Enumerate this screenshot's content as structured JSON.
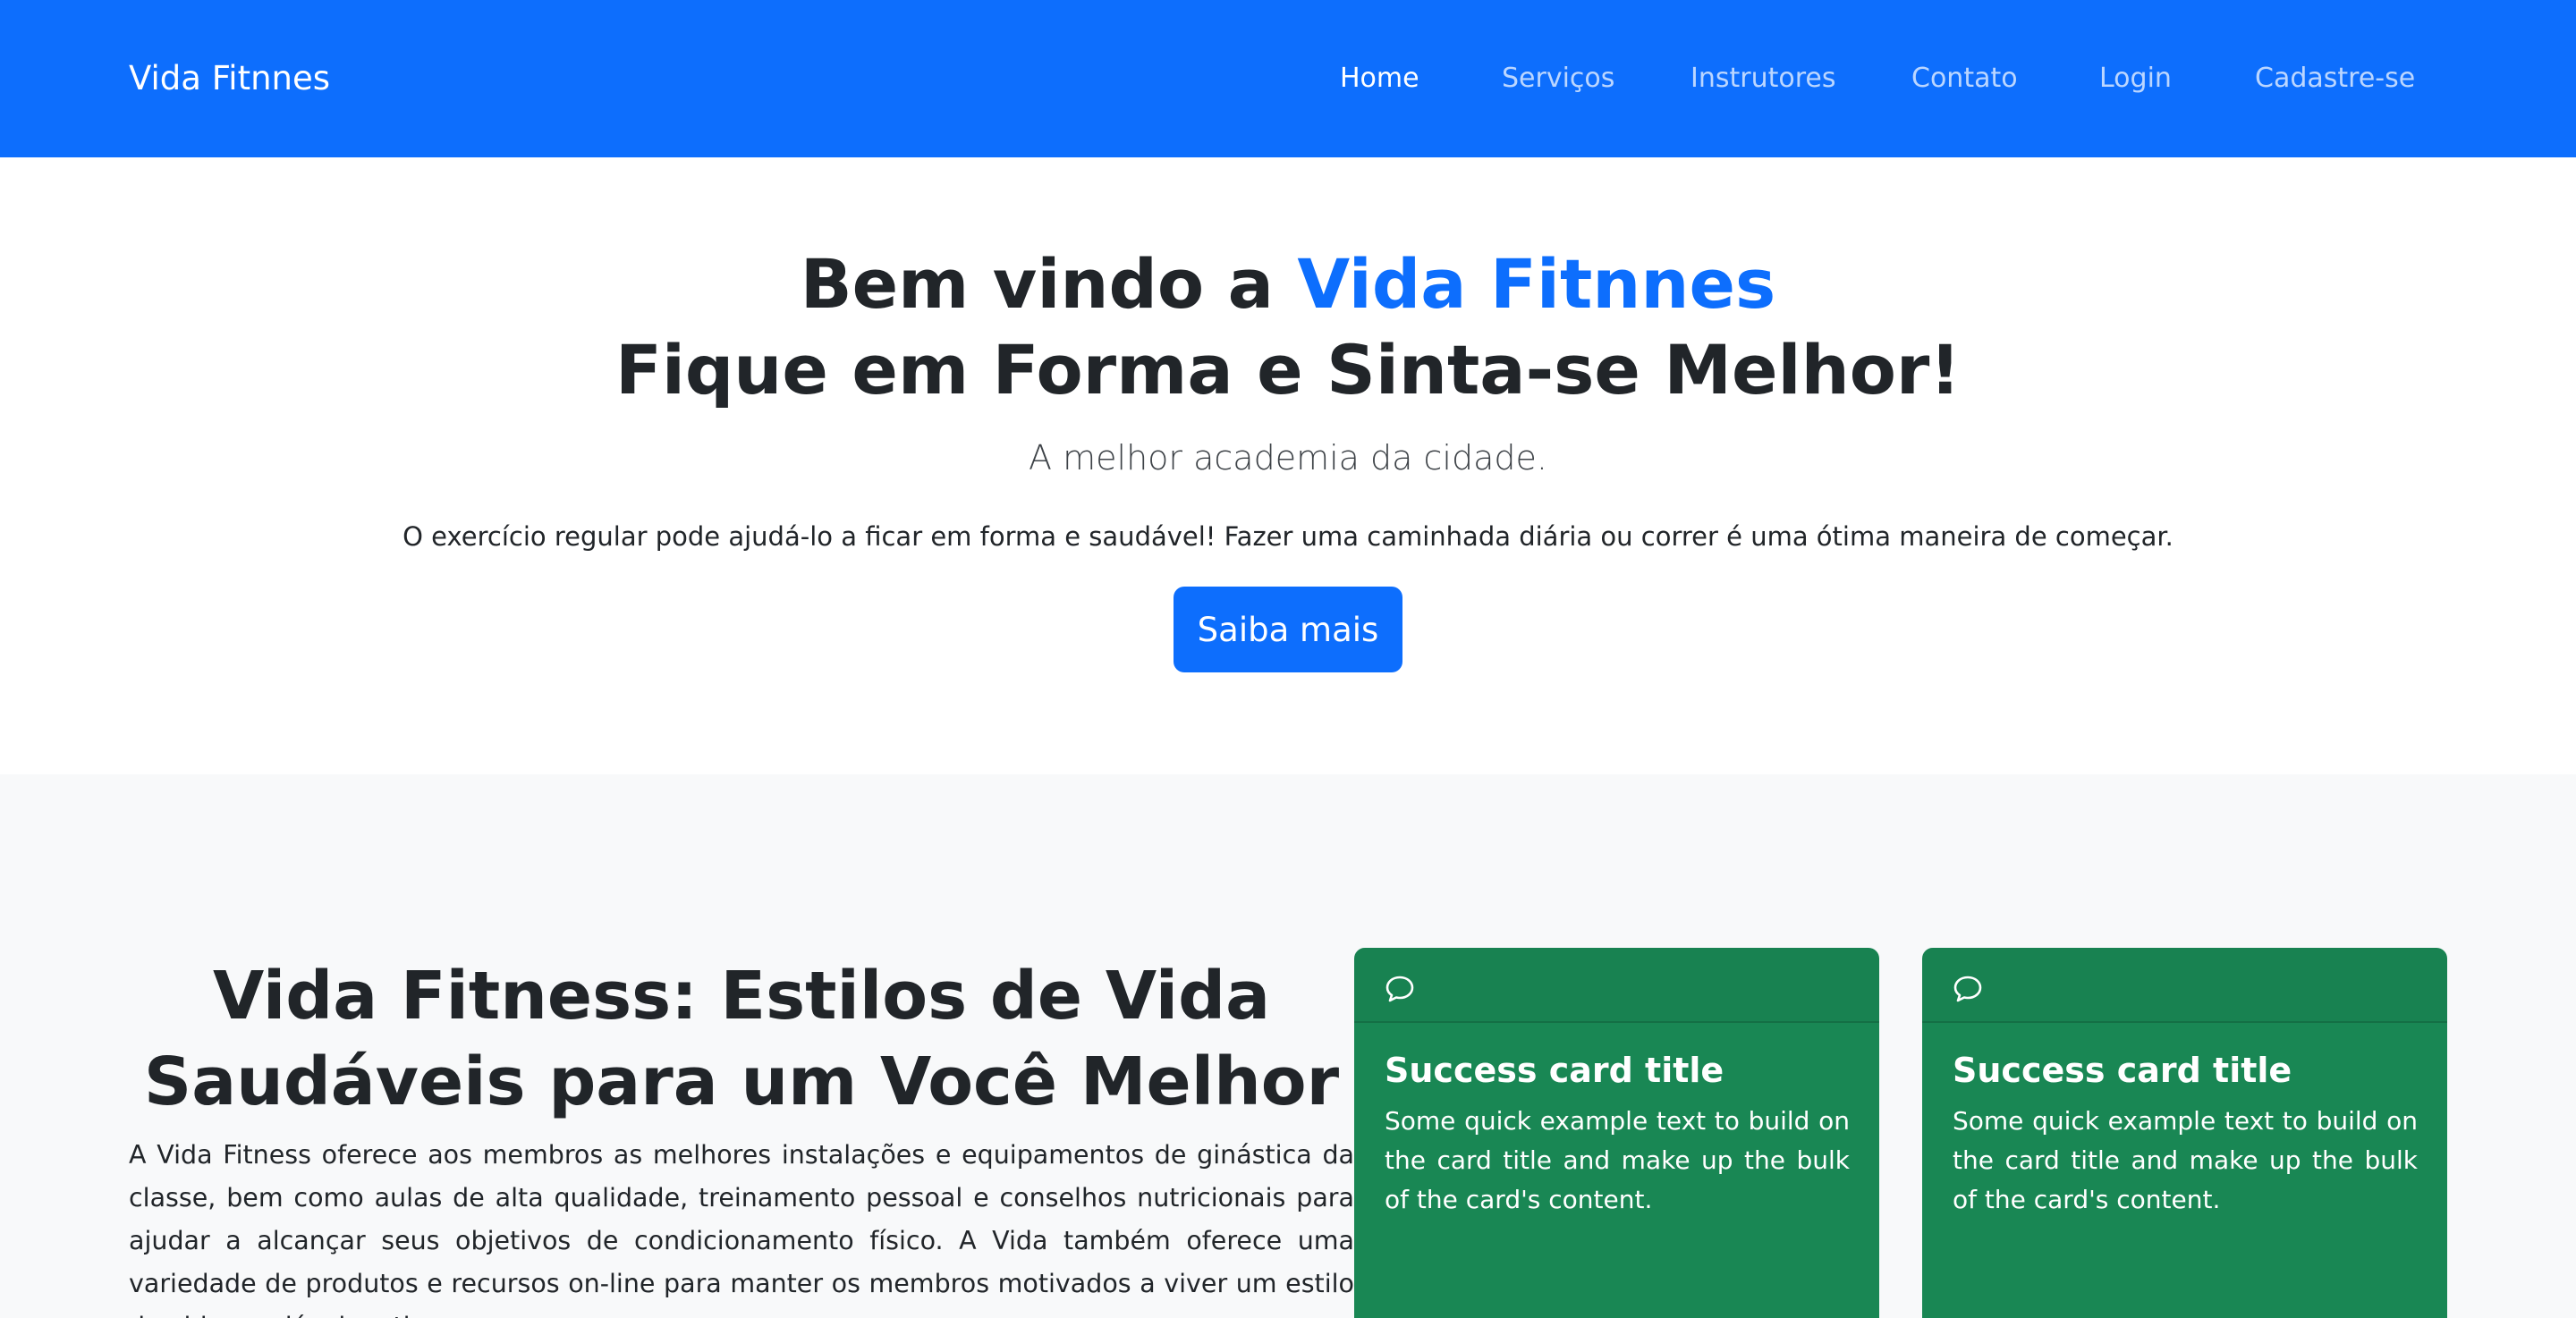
{
  "navbar": {
    "brand": "Vida Fitnnes",
    "links": [
      {
        "label": "Home",
        "active": true
      },
      {
        "label": "Serviços",
        "active": false
      },
      {
        "label": "Instrutores",
        "active": false
      },
      {
        "label": "Contato",
        "active": false
      },
      {
        "label": "Login",
        "active": false
      },
      {
        "label": "Cadastre-se",
        "active": false
      }
    ]
  },
  "hero": {
    "title_prefix": "Bem vindo a ",
    "title_accent": "Vida Fitnnes",
    "subtitle": "Fique em Forma e Sinta-se Melhor!",
    "lead": "A melhor academia da cidade.",
    "text": "O exercício regular pode ajudá-lo a ficar em forma e saudável! Fazer uma caminhada diária ou correr é uma ótima maneira de começar.",
    "button_label": "Saiba mais"
  },
  "features": {
    "title": "Vida Fitness: Estilos de Vida Saudáveis para um Você Melhor",
    "text": "A Vida Fitness oferece aos membros as melhores instalações e equipamentos de ginástica da classe, bem como aulas de alta qualidade, treinamento pessoal e conselhos nutricionais para ajudar a alcançar seus objetivos de condicionamento físico. A Vida também oferece uma variedade de produtos e recursos on-line para manter os membros motivados a viver um estilo de vida saudável e ativo."
  },
  "cards": [
    {
      "icon": "chat-icon",
      "title": "Success card title",
      "text": "Some quick example text to build on the card title and make up the bulk of the card's content."
    },
    {
      "icon": "chat-icon",
      "title": "Success card title",
      "text": "Some quick example text to build on the card title and make up the bulk of the card's content."
    }
  ],
  "colors": {
    "primary": "#0d6efd",
    "success": "#198754",
    "light_bg": "#f8f9fa",
    "text": "#212529"
  }
}
